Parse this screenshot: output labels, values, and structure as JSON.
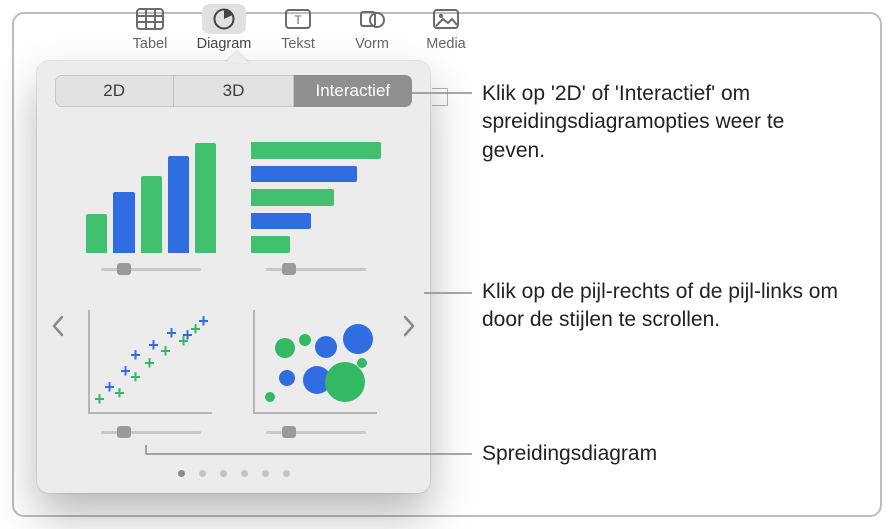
{
  "toolbar": {
    "items": [
      {
        "label": "Tabel",
        "icon": "table-icon"
      },
      {
        "label": "Diagram",
        "icon": "piechart-icon",
        "selected": true
      },
      {
        "label": "Tekst",
        "icon": "textbox-icon"
      },
      {
        "label": "Vorm",
        "icon": "shape-icon"
      },
      {
        "label": "Media",
        "icon": "image-icon"
      }
    ]
  },
  "chart_popover": {
    "tabs": [
      {
        "label": "2D",
        "active": false
      },
      {
        "label": "3D",
        "active": false
      },
      {
        "label": "Interactief",
        "active": true
      }
    ],
    "page_count": 6,
    "current_page": 1,
    "chart_types": [
      {
        "name": "interactive-column-chart",
        "semantic": "Kolomdiagram"
      },
      {
        "name": "interactive-bar-chart",
        "semantic": "Staafdiagram"
      },
      {
        "name": "interactive-scatter-chart",
        "semantic": "Spreidingsdiagram"
      },
      {
        "name": "interactive-bubble-chart",
        "semantic": "Bellendiagram"
      }
    ]
  },
  "callouts": {
    "tabs_hint": "Klik op '2D' of 'Interactief' om spreidingsdiagramopties weer te geven.",
    "arrows_hint": "Klik op de pijl-rechts of de pijl-links om door de stijlen te scrollen.",
    "scatter_label": "Spreidingsdiagram"
  }
}
